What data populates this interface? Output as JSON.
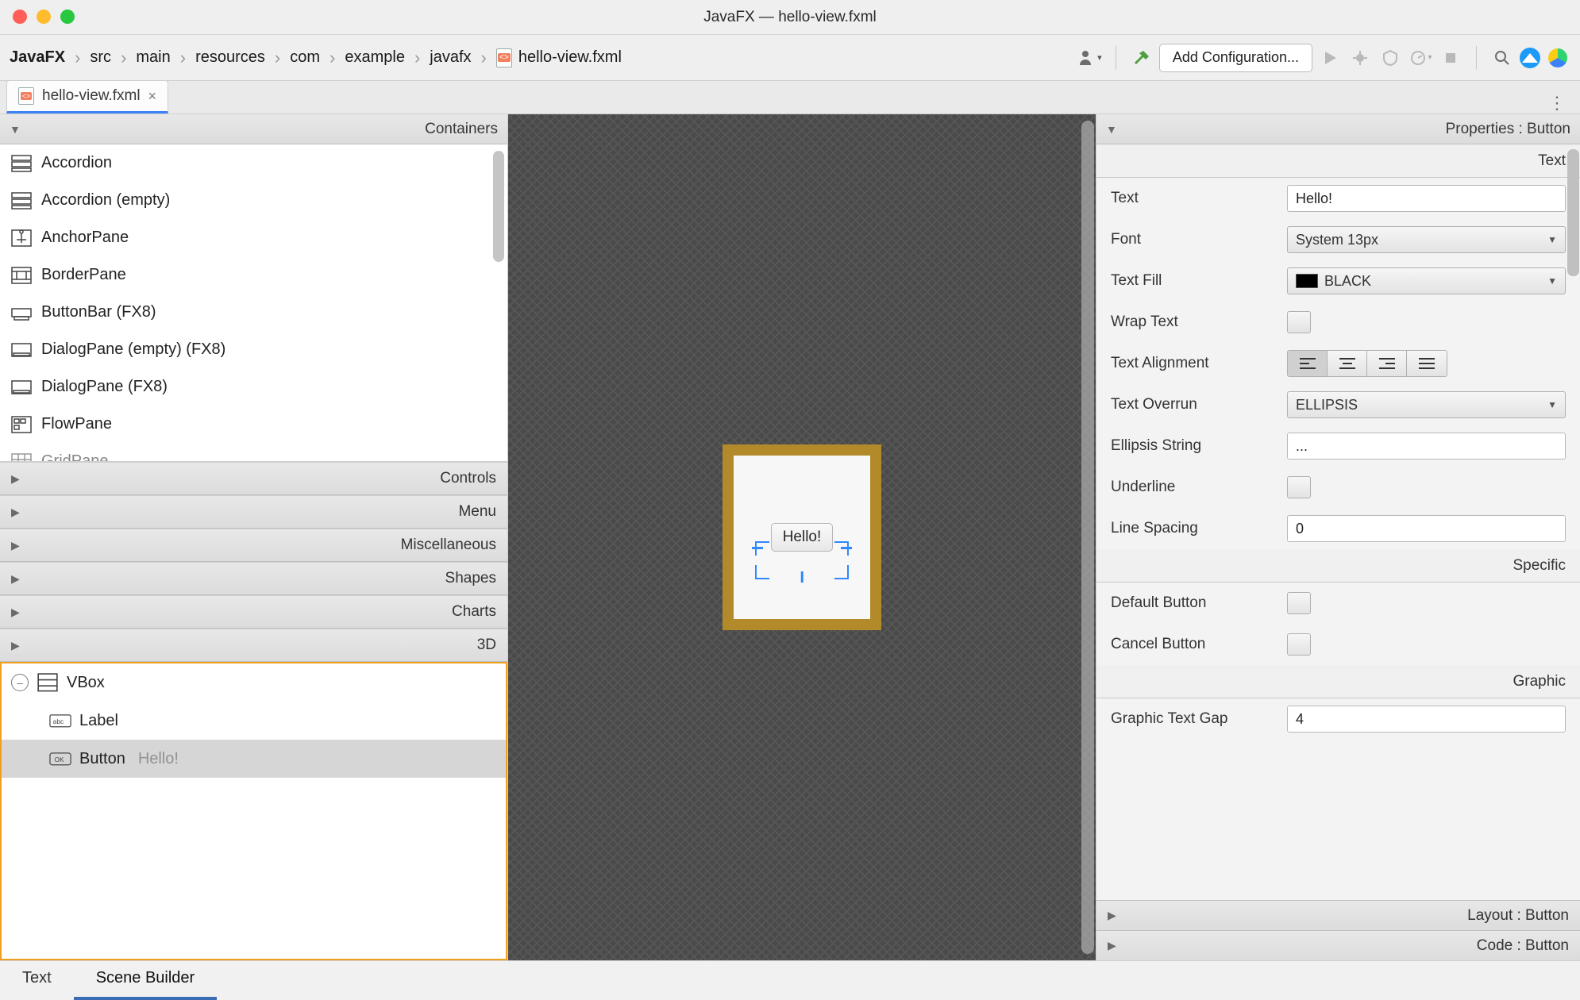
{
  "window": {
    "title": "JavaFX — hello-view.fxml"
  },
  "breadcrumbs": [
    "JavaFX",
    "src",
    "main",
    "resources",
    "com",
    "example",
    "javafx",
    "hello-view.fxml"
  ],
  "toolbar": {
    "run_config": "Add Configuration..."
  },
  "tab": {
    "name": "hello-view.fxml"
  },
  "left": {
    "panel_title": "Containers",
    "containers": [
      "Accordion",
      "Accordion  (empty)",
      "AnchorPane",
      "BorderPane",
      "ButtonBar  (FX8)",
      "DialogPane (empty)  (FX8)",
      "DialogPane  (FX8)",
      "FlowPane",
      "GridPane"
    ],
    "sections": [
      "Controls",
      "Menu",
      "Miscellaneous",
      "Shapes",
      "Charts",
      "3D"
    ],
    "tree": {
      "root": "VBox",
      "child1": "Label",
      "child2": "Button",
      "child2_text": "Hello!"
    }
  },
  "canvas": {
    "button_text": "Hello!"
  },
  "props": {
    "header": "Properties : Button",
    "section_text": "Text",
    "section_specific": "Specific",
    "section_graphic": "Graphic",
    "labels": {
      "text": "Text",
      "font": "Font",
      "text_fill": "Text Fill",
      "wrap": "Wrap Text",
      "align": "Text Alignment",
      "overrun": "Text Overrun",
      "ellipsis": "Ellipsis String",
      "underline": "Underline",
      "line_spacing": "Line Spacing",
      "default_btn": "Default Button",
      "cancel_btn": "Cancel Button",
      "graphic_gap": "Graphic Text Gap"
    },
    "values": {
      "text": "Hello!",
      "font": "System 13px",
      "text_fill": "BLACK",
      "overrun": "ELLIPSIS",
      "ellipsis": "...",
      "line_spacing": "0",
      "graphic_gap": "4"
    },
    "layout_head": "Layout : Button",
    "code_head": "Code : Button"
  },
  "bottom": {
    "tab_text": "Text",
    "tab_sb": "Scene Builder"
  }
}
